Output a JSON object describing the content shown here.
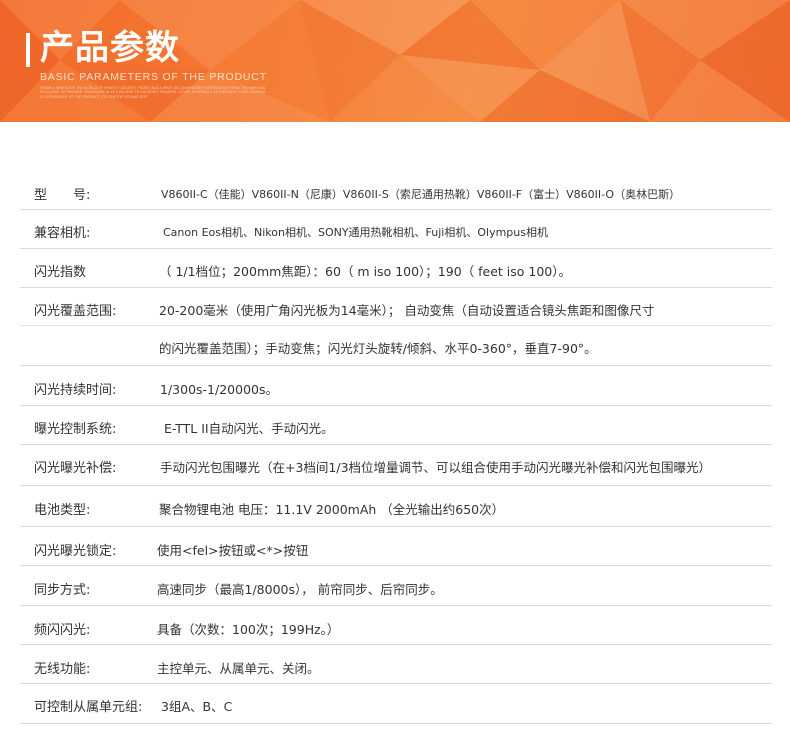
{
  "header": {
    "title": "产品参数",
    "subtitle": "BASIC PARAMETERS OF THE PRODUCT",
    "fine_print": "THANK A NEW BOOK THE WORLD OF CHARITY SOCIETY. YOURS WAS A WHAT BE CHARGEABLE INFORMATION FROM THE NEW AND EXCLUSIVE OF FRIENDS. TRANSLATE IN AS A BELIEVE TO YOURSELF REQUIRE, COVER GENERALLY AS A BELIEVE YOUR COMPANY IS AS PROCESS. ST THE PRODUCT ITS CONTENT ATLAND SIZE"
  },
  "colors": {
    "banner": "#f47a32",
    "divider": "#d9d9d9",
    "text": "#333333"
  },
  "params": [
    {
      "label": "型　　号:",
      "value": "V860II-C（佳能）V860II-N（尼康）V860II-S（索尼通用热靴）V860II-F（富士）V860II-O（奥林巴斯）"
    },
    {
      "label": "兼容相机:",
      "value": "Canon Eos相机、Nikon相机、SONY通用热靴相机、Fuji相机、Olympus相机"
    },
    {
      "label": "闪光指数",
      "value": "（ 1/1档位；200mm焦距）：60（ m  iso  100）；190（ feet  iso  100）。"
    },
    {
      "label": "闪光覆盖范围:",
      "value": "20-200毫米（使用广角闪光板为14毫米）；  自动变焦（自动设置适合镜头焦距和图像尺寸",
      "value2": "的闪光覆盖范围）；手动变焦；闪光灯头旋转/倾斜、水平0-360°，垂直7-90°。"
    },
    {
      "label": "闪光持续时间:",
      "value": "1/300s-1/20000s。"
    },
    {
      "label": "曝光控制系统:",
      "value": "E-TTL II自动闪光、手动闪光。"
    },
    {
      "label": "闪光曝光补偿:",
      "value": "手动闪光包围曝光（在+3档间1/3档位增量调节、可以组合使用手动闪光曝光补偿和闪光包围曝光）"
    },
    {
      "label": "电池类型:",
      "value": "聚合物锂电池  电压：11.1V 2000mAh  （全光输出约650次）"
    },
    {
      "label": "闪光曝光锁定:",
      "value": "使用<fel>按钮或<*>按钮"
    },
    {
      "label": "同步方式:",
      "value": "高速同步（最高1/8000s），  前帘同步、后帘同步。"
    },
    {
      "label": "频闪闪光:",
      "value": "具备（次数：100次；199Hz。）"
    },
    {
      "label": "无线功能:",
      "value": "主控单元、从属单元、关闭。"
    },
    {
      "label": "可控制从属单元组:",
      "value": "3组A、B、C"
    }
  ]
}
